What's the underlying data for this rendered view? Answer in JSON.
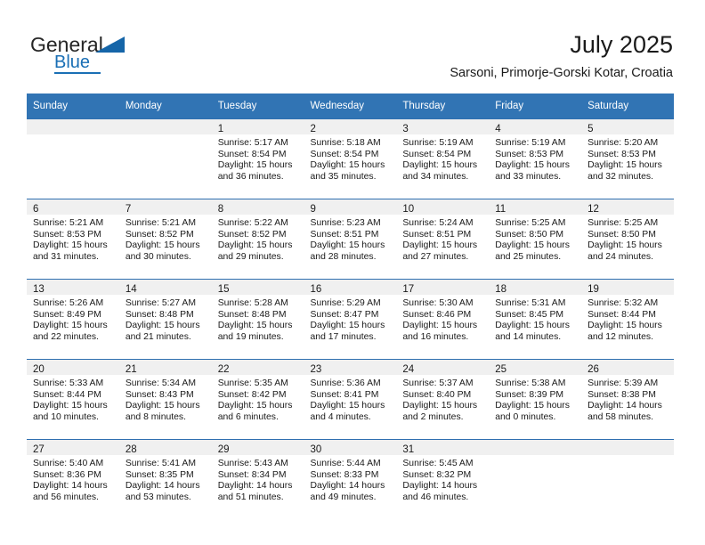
{
  "brand": {
    "word_one": "General",
    "word_two": "Blue",
    "triangle_icon": "triangle-icon",
    "accent_color": "#1a6fb5"
  },
  "header": {
    "title": "July 2025",
    "subtitle": "Sarsoni, Primorje-Gorski Kotar, Croatia"
  },
  "theme": {
    "header_row_bg": "#3174b4",
    "grid_line": "#2f6fb0",
    "daynum_bar_bg": "#f0f0f0",
    "text": "#1a1a1a"
  },
  "weekday_headers": [
    "Sunday",
    "Monday",
    "Tuesday",
    "Wednesday",
    "Thursday",
    "Friday",
    "Saturday"
  ],
  "weeks": [
    [
      {
        "day": "",
        "lines": []
      },
      {
        "day": "",
        "lines": []
      },
      {
        "day": "1",
        "lines": [
          "Sunrise: 5:17 AM",
          "Sunset: 8:54 PM",
          "Daylight: 15 hours",
          "and 36 minutes."
        ]
      },
      {
        "day": "2",
        "lines": [
          "Sunrise: 5:18 AM",
          "Sunset: 8:54 PM",
          "Daylight: 15 hours",
          "and 35 minutes."
        ]
      },
      {
        "day": "3",
        "lines": [
          "Sunrise: 5:19 AM",
          "Sunset: 8:54 PM",
          "Daylight: 15 hours",
          "and 34 minutes."
        ]
      },
      {
        "day": "4",
        "lines": [
          "Sunrise: 5:19 AM",
          "Sunset: 8:53 PM",
          "Daylight: 15 hours",
          "and 33 minutes."
        ]
      },
      {
        "day": "5",
        "lines": [
          "Sunrise: 5:20 AM",
          "Sunset: 8:53 PM",
          "Daylight: 15 hours",
          "and 32 minutes."
        ]
      }
    ],
    [
      {
        "day": "6",
        "lines": [
          "Sunrise: 5:21 AM",
          "Sunset: 8:53 PM",
          "Daylight: 15 hours",
          "and 31 minutes."
        ]
      },
      {
        "day": "7",
        "lines": [
          "Sunrise: 5:21 AM",
          "Sunset: 8:52 PM",
          "Daylight: 15 hours",
          "and 30 minutes."
        ]
      },
      {
        "day": "8",
        "lines": [
          "Sunrise: 5:22 AM",
          "Sunset: 8:52 PM",
          "Daylight: 15 hours",
          "and 29 minutes."
        ]
      },
      {
        "day": "9",
        "lines": [
          "Sunrise: 5:23 AM",
          "Sunset: 8:51 PM",
          "Daylight: 15 hours",
          "and 28 minutes."
        ]
      },
      {
        "day": "10",
        "lines": [
          "Sunrise: 5:24 AM",
          "Sunset: 8:51 PM",
          "Daylight: 15 hours",
          "and 27 minutes."
        ]
      },
      {
        "day": "11",
        "lines": [
          "Sunrise: 5:25 AM",
          "Sunset: 8:50 PM",
          "Daylight: 15 hours",
          "and 25 minutes."
        ]
      },
      {
        "day": "12",
        "lines": [
          "Sunrise: 5:25 AM",
          "Sunset: 8:50 PM",
          "Daylight: 15 hours",
          "and 24 minutes."
        ]
      }
    ],
    [
      {
        "day": "13",
        "lines": [
          "Sunrise: 5:26 AM",
          "Sunset: 8:49 PM",
          "Daylight: 15 hours",
          "and 22 minutes."
        ]
      },
      {
        "day": "14",
        "lines": [
          "Sunrise: 5:27 AM",
          "Sunset: 8:48 PM",
          "Daylight: 15 hours",
          "and 21 minutes."
        ]
      },
      {
        "day": "15",
        "lines": [
          "Sunrise: 5:28 AM",
          "Sunset: 8:48 PM",
          "Daylight: 15 hours",
          "and 19 minutes."
        ]
      },
      {
        "day": "16",
        "lines": [
          "Sunrise: 5:29 AM",
          "Sunset: 8:47 PM",
          "Daylight: 15 hours",
          "and 17 minutes."
        ]
      },
      {
        "day": "17",
        "lines": [
          "Sunrise: 5:30 AM",
          "Sunset: 8:46 PM",
          "Daylight: 15 hours",
          "and 16 minutes."
        ]
      },
      {
        "day": "18",
        "lines": [
          "Sunrise: 5:31 AM",
          "Sunset: 8:45 PM",
          "Daylight: 15 hours",
          "and 14 minutes."
        ]
      },
      {
        "day": "19",
        "lines": [
          "Sunrise: 5:32 AM",
          "Sunset: 8:44 PM",
          "Daylight: 15 hours",
          "and 12 minutes."
        ]
      }
    ],
    [
      {
        "day": "20",
        "lines": [
          "Sunrise: 5:33 AM",
          "Sunset: 8:44 PM",
          "Daylight: 15 hours",
          "and 10 minutes."
        ]
      },
      {
        "day": "21",
        "lines": [
          "Sunrise: 5:34 AM",
          "Sunset: 8:43 PM",
          "Daylight: 15 hours",
          "and 8 minutes."
        ]
      },
      {
        "day": "22",
        "lines": [
          "Sunrise: 5:35 AM",
          "Sunset: 8:42 PM",
          "Daylight: 15 hours",
          "and 6 minutes."
        ]
      },
      {
        "day": "23",
        "lines": [
          "Sunrise: 5:36 AM",
          "Sunset: 8:41 PM",
          "Daylight: 15 hours",
          "and 4 minutes."
        ]
      },
      {
        "day": "24",
        "lines": [
          "Sunrise: 5:37 AM",
          "Sunset: 8:40 PM",
          "Daylight: 15 hours",
          "and 2 minutes."
        ]
      },
      {
        "day": "25",
        "lines": [
          "Sunrise: 5:38 AM",
          "Sunset: 8:39 PM",
          "Daylight: 15 hours",
          "and 0 minutes."
        ]
      },
      {
        "day": "26",
        "lines": [
          "Sunrise: 5:39 AM",
          "Sunset: 8:38 PM",
          "Daylight: 14 hours",
          "and 58 minutes."
        ]
      }
    ],
    [
      {
        "day": "27",
        "lines": [
          "Sunrise: 5:40 AM",
          "Sunset: 8:36 PM",
          "Daylight: 14 hours",
          "and 56 minutes."
        ]
      },
      {
        "day": "28",
        "lines": [
          "Sunrise: 5:41 AM",
          "Sunset: 8:35 PM",
          "Daylight: 14 hours",
          "and 53 minutes."
        ]
      },
      {
        "day": "29",
        "lines": [
          "Sunrise: 5:43 AM",
          "Sunset: 8:34 PM",
          "Daylight: 14 hours",
          "and 51 minutes."
        ]
      },
      {
        "day": "30",
        "lines": [
          "Sunrise: 5:44 AM",
          "Sunset: 8:33 PM",
          "Daylight: 14 hours",
          "and 49 minutes."
        ]
      },
      {
        "day": "31",
        "lines": [
          "Sunrise: 5:45 AM",
          "Sunset: 8:32 PM",
          "Daylight: 14 hours",
          "and 46 minutes."
        ]
      },
      {
        "day": "",
        "lines": []
      },
      {
        "day": "",
        "lines": []
      }
    ]
  ]
}
